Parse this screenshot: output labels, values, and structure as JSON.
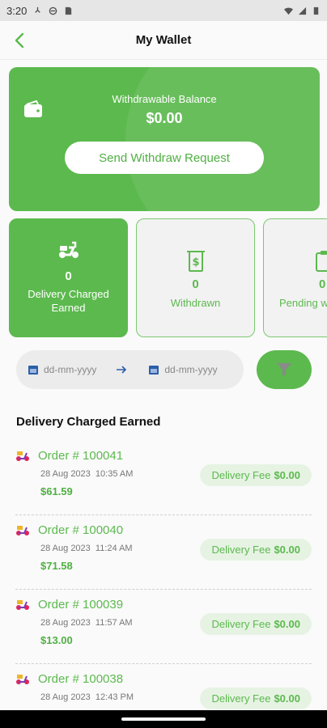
{
  "status_bar": {
    "time": "3:20"
  },
  "header": {
    "title": "My Wallet"
  },
  "balance": {
    "label": "Withdrawable Balance",
    "value": "$0.00",
    "button_label": "Send Withdraw Request"
  },
  "stats": [
    {
      "value": "0",
      "label_line1": "Delivery Charged",
      "label_line2": "Earned",
      "icon": "scooter-icon",
      "active": true
    },
    {
      "value": "0",
      "label_line1": "Withdrawn",
      "label_line2": "",
      "icon": "dollar-receipt-icon",
      "active": false
    },
    {
      "value": "0",
      "label_line1": "Pending w",
      "label_line2": "",
      "icon": "pending-clipboard-icon",
      "active": false
    }
  ],
  "filter": {
    "from_placeholder": "dd-mm-yyyy",
    "to_placeholder": "dd-mm-yyyy"
  },
  "section": {
    "title": "Delivery Charged Earned"
  },
  "orders": [
    {
      "order_no": "Order # 100041",
      "date": "28 Aug 2023",
      "time": "10:35 AM",
      "amount": "$61.59",
      "fee_label": "Delivery Fee",
      "fee_value": "$0.00"
    },
    {
      "order_no": "Order # 100040",
      "date": "28 Aug 2023",
      "time": "11:24 AM",
      "amount": "$71.58",
      "fee_label": "Delivery Fee",
      "fee_value": "$0.00"
    },
    {
      "order_no": "Order # 100039",
      "date": "28 Aug 2023",
      "time": "11:57 AM",
      "amount": "$13.00",
      "fee_label": "Delivery Fee",
      "fee_value": "$0.00"
    },
    {
      "order_no": "Order # 100038",
      "date": "28 Aug 2023",
      "time": "12:43 PM",
      "amount": "",
      "fee_label": "Delivery Fee",
      "fee_value": "$0.00"
    }
  ],
  "colors": {
    "accent": "#5cb94e",
    "accent_light": "#e6f3e3"
  }
}
